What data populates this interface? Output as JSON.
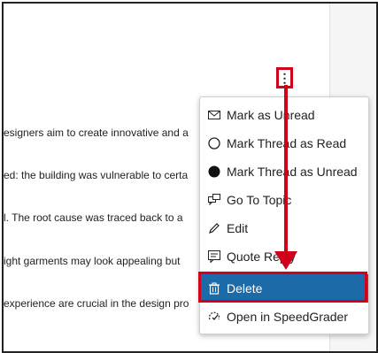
{
  "snippets": [
    "esigners aim to create innovative and a",
    "ed: the building was vulnerable to certa",
    "l. The root cause was traced back to a",
    "ight garments may look appealing but",
    "experience are crucial in the design pro"
  ],
  "more_button": {
    "label": "⋮",
    "icon": "vertical-ellipsis-icon"
  },
  "menu": {
    "items": [
      {
        "label": "Mark as Unread",
        "icon": "mail-icon"
      },
      {
        "label": "Mark Thread as Read",
        "icon": "empty-circle-icon"
      },
      {
        "label": "Mark Thread as Unread",
        "icon": "filled-circle-icon"
      },
      {
        "label": "Go To Topic",
        "icon": "discussions-icon"
      },
      {
        "label": "Edit",
        "icon": "pencil-icon"
      },
      {
        "label": "Quote Reply",
        "icon": "quote-icon"
      },
      {
        "label": "Delete",
        "icon": "trash-icon",
        "selected": true
      },
      {
        "label": "Open in SpeedGrader",
        "icon": "speedgrader-icon"
      }
    ]
  },
  "colors": {
    "annotation_red": "#d0021b",
    "selected_bg": "#1c6aa8"
  }
}
